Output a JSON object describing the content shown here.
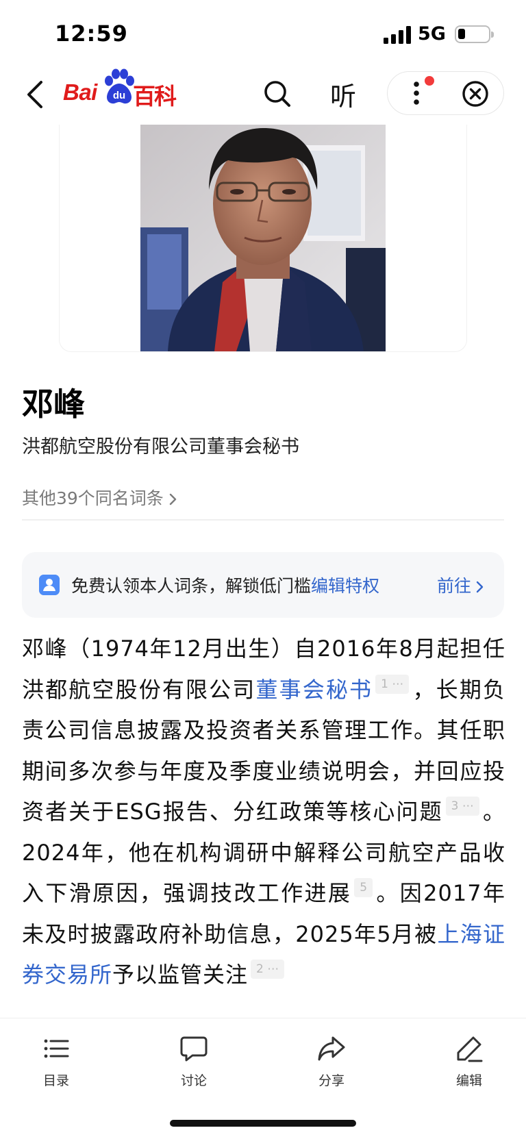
{
  "status_bar": {
    "time": "12:59",
    "network": "5G",
    "battery_level": 0.2
  },
  "nav": {
    "logo_bai": "Bai",
    "logo_du": "du",
    "logo_baike": "百科",
    "listen_label": "听"
  },
  "entry": {
    "name": "邓峰",
    "subtitle": "洪都航空股份有限公司董事会秘书",
    "other_entries": "其他39个同名词条"
  },
  "claim_banner": {
    "text": "免费认领本人词条，解锁低门槛",
    "highlight": "编辑特权",
    "action": "前往"
  },
  "summary": {
    "seg1": "邓峰（1974年12月出生）自2016年8月起担任洪都航空股份有限公司",
    "link1": "董事会秘书",
    "ref1": "1",
    "seg2": "，长期负责公司信息披露及投资者关系管理工作。其任职期间多次参与年度及季度业绩说明会，并回应投资者关于ESG报告、分红政策等核心问题",
    "ref2": "3",
    "seg3": "。2024年，他在机构调研中解释公司航空产品收入下滑原因，强调技改工作进展",
    "ref3": "5",
    "seg4": "。因2017年未及时披露政府补助信息，2025年5月被",
    "link2": "上海证券交易所",
    "seg5": "予以监管关注",
    "ref4": "2"
  },
  "toolbar": {
    "toc": "目录",
    "discuss": "讨论",
    "share": "分享",
    "edit": "编辑"
  },
  "colors": {
    "brand_red": "#e01b1b",
    "link_blue": "#3366cc",
    "brand_blue": "#2c3fd6"
  }
}
